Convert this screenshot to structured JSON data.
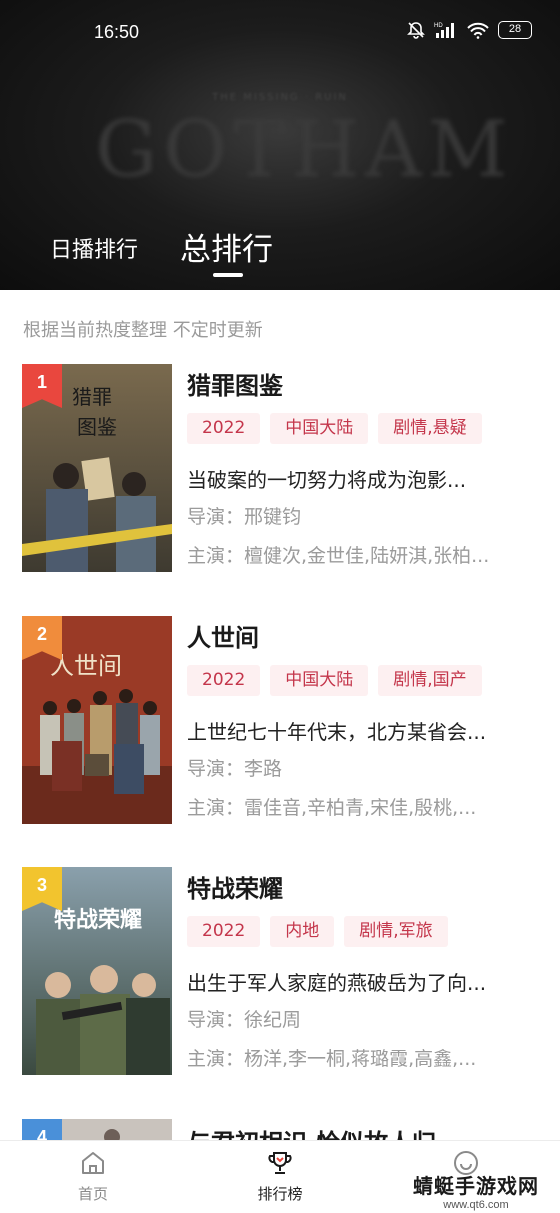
{
  "status_bar": {
    "time": "16:50",
    "battery": "28"
  },
  "hero": {
    "banner_text": "GOTHAM"
  },
  "tabs": [
    {
      "label": "日播排行",
      "active": false
    },
    {
      "label": "总排行",
      "active": true
    }
  ],
  "subtitle": "根据当前热度整理 不定时更新",
  "items": [
    {
      "rank": "1",
      "rank_color": "#e9473e",
      "title": "猎罪图鉴",
      "tags": [
        "2022",
        "中国大陆",
        "剧情,悬疑"
      ],
      "desc": "当破案的一切努力将成为泡影...",
      "director": "导演：邢键钧",
      "cast": "主演：檀健次,金世佳,陆妍淇,张柏..."
    },
    {
      "rank": "2",
      "rank_color": "#f08c3c",
      "title": "人世间",
      "tags": [
        "2022",
        "中国大陆",
        "剧情,国产"
      ],
      "desc": "上世纪七十年代末，北方某省会...",
      "director": "导演：李路",
      "cast": "主演：雷佳音,辛柏青,宋佳,殷桃,..."
    },
    {
      "rank": "3",
      "rank_color": "#f2c42e",
      "title": "特战荣耀",
      "tags": [
        "2022",
        "内地",
        "剧情,军旅"
      ],
      "desc": "出生于军人家庭的燕破岳为了向...",
      "director": "导演：徐纪周",
      "cast": "主演：杨洋,李一桐,蒋璐霞,高鑫,..."
    },
    {
      "rank": "4",
      "rank_color": "#4a90d9",
      "title": "与君初相识·恰似故人归"
    }
  ],
  "bottom_nav": [
    {
      "label": "首页",
      "icon": "home-icon"
    },
    {
      "label": "排行榜",
      "icon": "trophy-icon"
    },
    {
      "label": "我的",
      "icon": "user-icon"
    }
  ],
  "watermark": {
    "main": "蜻蜓手游戏网",
    "url": "www.qt6.com"
  },
  "colors": {
    "tag_bg": "#fdf0f1",
    "tag_text": "#c4364b",
    "header_bg": "#141414"
  }
}
